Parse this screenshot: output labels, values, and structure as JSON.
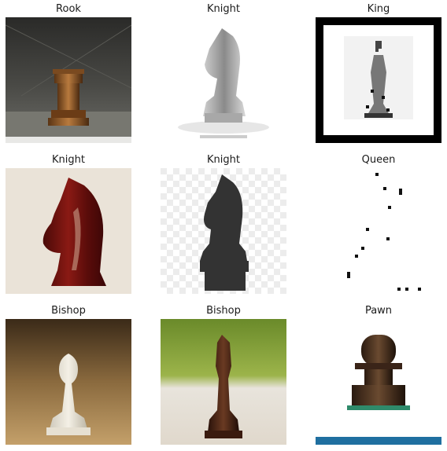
{
  "figure": {
    "panels": [
      {
        "title": "Rook",
        "piece_icon": "rook-icon"
      },
      {
        "title": "Knight",
        "piece_icon": "knight-icon"
      },
      {
        "title": "King",
        "piece_icon": "king-icon"
      },
      {
        "title": "Knight",
        "piece_icon": "knight-icon"
      },
      {
        "title": "Knight",
        "piece_icon": "knight-icon"
      },
      {
        "title": "Queen",
        "piece_icon": "queen-icon"
      },
      {
        "title": "Bishop",
        "piece_icon": "bishop-icon"
      },
      {
        "title": "Bishop",
        "piece_icon": "bishop-icon"
      },
      {
        "title": "Pawn",
        "piece_icon": "pawn-icon"
      }
    ]
  }
}
